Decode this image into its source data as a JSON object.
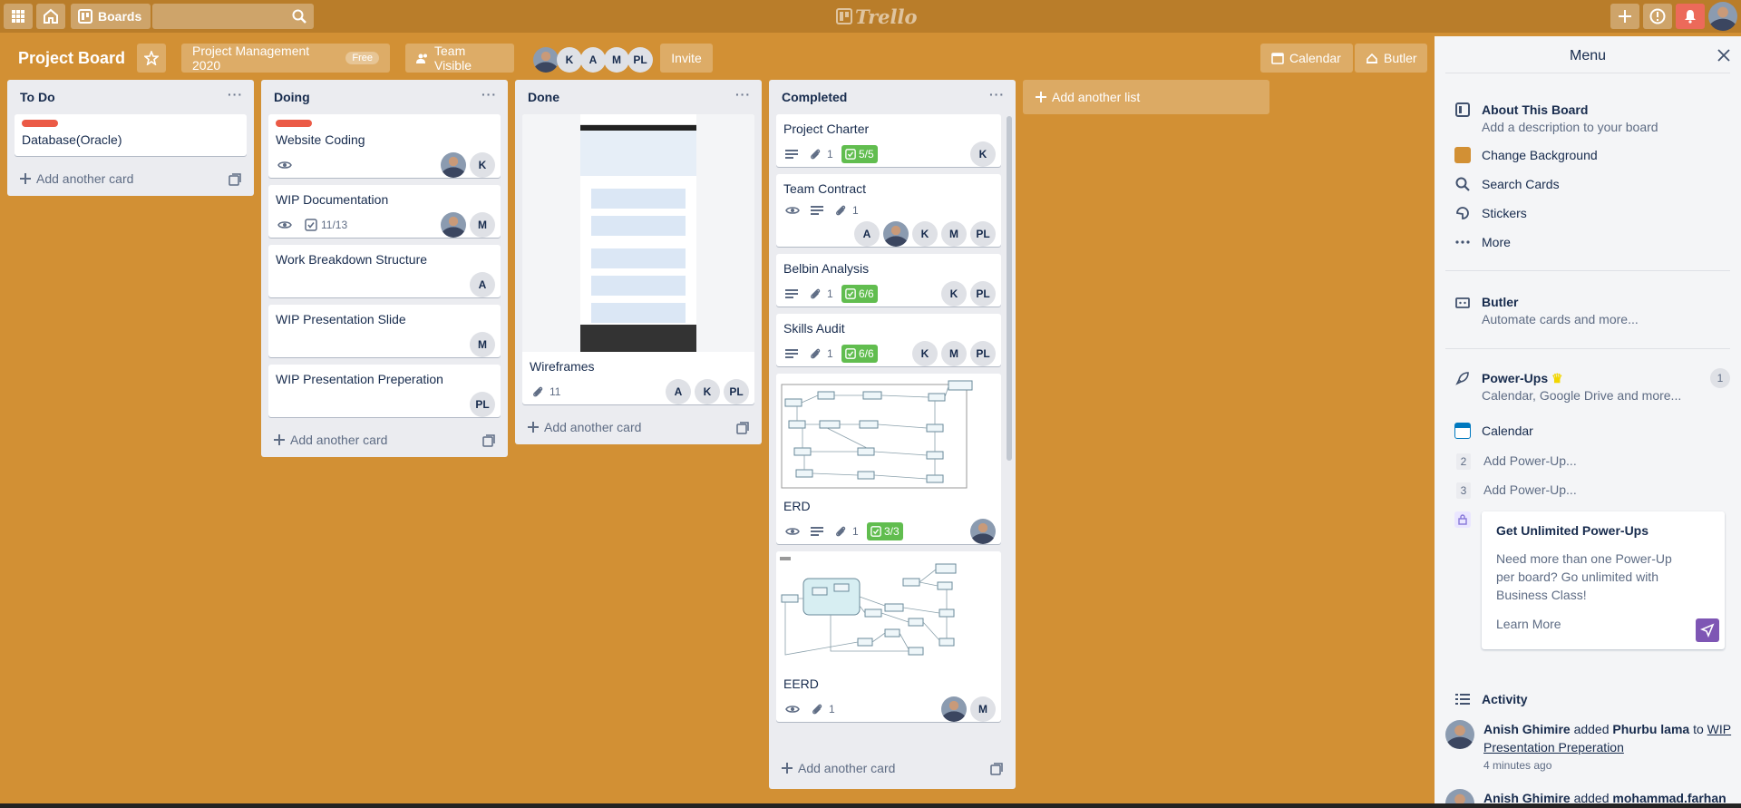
{
  "topbar": {
    "boards_label": "Boards",
    "logo_text": "Trello"
  },
  "board": {
    "title": "Project Board",
    "workspace_label": "Project Management 2020",
    "workspace_badge": "Free",
    "visibility_label": "Team Visible",
    "members": [
      "K",
      "A",
      "M",
      "PL"
    ],
    "invite_label": "Invite",
    "calendar_label": "Calendar",
    "butler_label": "Butler"
  },
  "lists": {
    "todo": {
      "title": "To Do",
      "cards": [
        "Database(Oracle)"
      ],
      "add_label": "Add another card"
    },
    "doing": {
      "title": "Doing",
      "cards": [
        {
          "title": "Website Coding",
          "members": [
            "K"
          ]
        },
        {
          "title": "WIP Documentation",
          "checklist": "11/13",
          "members": [
            "M"
          ]
        },
        {
          "title": "Work Breakdown Structure",
          "members": [
            "A"
          ]
        },
        {
          "title": "WIP Presentation Slide",
          "members": [
            "M"
          ]
        },
        {
          "title": "WIP Presentation Preperation",
          "members": [
            "PL"
          ]
        }
      ],
      "add_label": "Add another card"
    },
    "done": {
      "title": "Done",
      "cards": [
        {
          "title": "Wireframes",
          "attachments": "11",
          "members": [
            "A",
            "K",
            "PL"
          ]
        }
      ],
      "add_label": "Add another card"
    },
    "completed": {
      "title": "Completed",
      "cards": [
        {
          "title": "Project Charter",
          "attachments": "1",
          "checklist": "5/5",
          "members": [
            "K"
          ]
        },
        {
          "title": "Team Contract",
          "attachments": "1",
          "members": [
            "A",
            "K",
            "M",
            "PL"
          ]
        },
        {
          "title": "Belbin Analysis",
          "attachments": "1",
          "checklist": "6/6",
          "members": [
            "K",
            "PL"
          ]
        },
        {
          "title": "Skills Audit",
          "attachments": "1",
          "checklist": "6/6",
          "members": [
            "K",
            "M",
            "PL"
          ]
        },
        {
          "title": "ERD",
          "attachments": "1",
          "checklist": "3/3"
        },
        {
          "title": "EERD",
          "attachments": "1",
          "members": [
            "M"
          ]
        }
      ],
      "add_label": "Add another card"
    }
  },
  "add_list_label": "Add another list",
  "menu": {
    "title": "Menu",
    "about_title": "About This Board",
    "about_sub": "Add a description to your board",
    "change_background": "Change Background",
    "background_color": "#d29034",
    "search_cards": "Search Cards",
    "stickers": "Stickers",
    "more": "More",
    "butler_title": "Butler",
    "butler_sub": "Automate cards and more...",
    "powerups_title": "Power-Ups",
    "powerups_sub": "Calendar, Google Drive and more...",
    "powerups_count": "1",
    "calendar": "Calendar",
    "slot2": "2",
    "slot3": "3",
    "add_powerup": "Add Power-Up...",
    "promo_title": "Get Unlimited Power-Ups",
    "promo_text": "Need more than one Power-Up per board? Go unlimited with Business Class!",
    "promo_link": "Learn More",
    "activity_title": "Activity",
    "activity": [
      {
        "actor": "Anish Ghimire",
        "verb": "added",
        "target": "Phurbu lama",
        "prep": "to",
        "card": "WIP Presentation Preperation",
        "time": "4 minutes ago"
      },
      {
        "actor": "Anish Ghimire",
        "verb": "added",
        "target": "mohammad.farhan"
      }
    ]
  },
  "colors": {
    "board_bg": "#d29034",
    "topbar_bg": "#b97d2a",
    "label_red": "#eb5a46",
    "checklist_green": "#61bd4f",
    "notification_red": "#ec6a5a"
  }
}
